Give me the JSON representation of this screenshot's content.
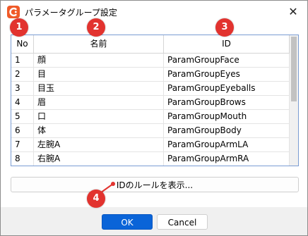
{
  "window": {
    "title": "パラメータグループ設定",
    "close_symbol": "✕"
  },
  "table": {
    "headers": {
      "no": "No",
      "name": "名前",
      "id": "ID"
    },
    "rows": [
      {
        "no": "1",
        "name": "顔",
        "id": "ParamGroupFace"
      },
      {
        "no": "2",
        "name": "目",
        "id": "ParamGroupEyes"
      },
      {
        "no": "3",
        "name": "目玉",
        "id": "ParamGroupEyeballs"
      },
      {
        "no": "4",
        "name": "眉",
        "id": "ParamGroupBrows"
      },
      {
        "no": "5",
        "name": "口",
        "id": "ParamGroupMouth"
      },
      {
        "no": "6",
        "name": "体",
        "id": "ParamGroupBody"
      },
      {
        "no": "7",
        "name": "左腕A",
        "id": "ParamGroupArmLA"
      },
      {
        "no": "8",
        "name": "右腕A",
        "id": "ParamGroupArmRA"
      }
    ]
  },
  "rule_button": {
    "label": "IDのルールを表示..."
  },
  "footer": {
    "ok_label": "OK",
    "cancel_label": "Cancel"
  },
  "annotations": {
    "badge1": "1",
    "badge2": "2",
    "badge3": "3",
    "badge4": "4"
  },
  "colors": {
    "accent": "#0a64d8",
    "badge": "#e2332f",
    "app_icon": "#f05a28"
  }
}
